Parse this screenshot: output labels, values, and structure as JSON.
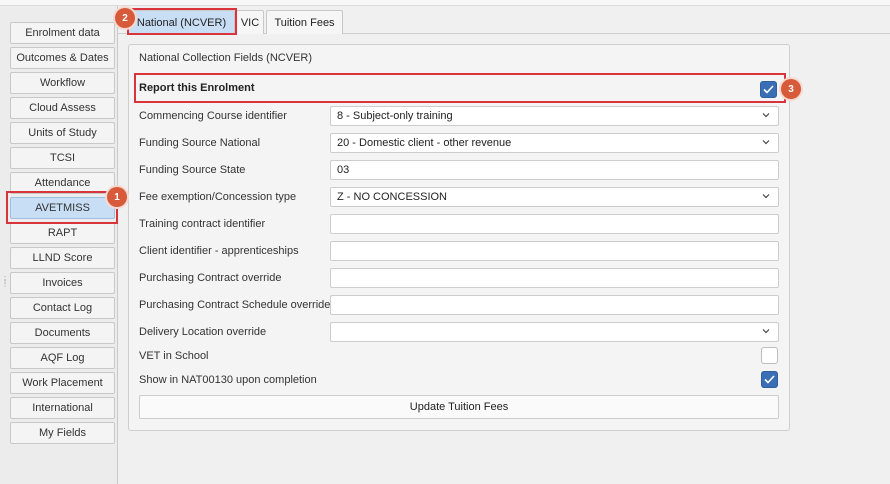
{
  "sidebar": {
    "items": [
      {
        "label": "Enrolment data"
      },
      {
        "label": "Outcomes & Dates"
      },
      {
        "label": "Workflow"
      },
      {
        "label": "Cloud Assess"
      },
      {
        "label": "Units of Study"
      },
      {
        "label": "TCSI"
      },
      {
        "label": "Attendance"
      },
      {
        "label": "AVETMISS",
        "active": true
      },
      {
        "label": "RAPT"
      },
      {
        "label": "LLND Score"
      },
      {
        "label": "Invoices"
      },
      {
        "label": "Contact Log"
      },
      {
        "label": "Documents"
      },
      {
        "label": "AQF Log"
      },
      {
        "label": "Work Placement"
      },
      {
        "label": "International"
      },
      {
        "label": "My Fields"
      }
    ]
  },
  "tabs": [
    {
      "label": "National (NCVER)",
      "active": true
    },
    {
      "label": "VIC"
    },
    {
      "label": "Tuition Fees"
    }
  ],
  "panel": {
    "title": "National Collection Fields (NCVER)",
    "report_label": "Report this Enrolment",
    "report_checked": true,
    "rows": [
      {
        "label": "Commencing Course identifier",
        "value": "8 - Subject-only training",
        "type": "select"
      },
      {
        "label": "Funding Source National",
        "value": "20 - Domestic client - other revenue",
        "type": "select"
      },
      {
        "label": "Funding Source State",
        "value": "03",
        "type": "text"
      },
      {
        "label": "Fee exemption/Concession type",
        "value": "Z - NO CONCESSION",
        "type": "select"
      },
      {
        "label": "Training contract identifier",
        "value": "",
        "type": "text"
      },
      {
        "label": "Client identifier - apprenticeships",
        "value": "",
        "type": "text"
      },
      {
        "label": "Purchasing Contract override",
        "value": "",
        "type": "text"
      },
      {
        "label": "Purchasing Contract Schedule override",
        "value": "",
        "type": "text"
      },
      {
        "label": "Delivery Location override",
        "value": "",
        "type": "select"
      }
    ],
    "vet_in_school_label": "VET in School",
    "vet_in_school_checked": false,
    "show_nat_label": "Show in NAT00130 upon completion",
    "show_nat_checked": true,
    "update_button": "Update Tuition Fees"
  },
  "badges": {
    "one": "1",
    "two": "2",
    "three": "3"
  },
  "colors": {
    "accent": "#3a6fb6",
    "highlight": "#d9333b",
    "badge": "#d75a3a",
    "active_tab": "#c8def5"
  }
}
